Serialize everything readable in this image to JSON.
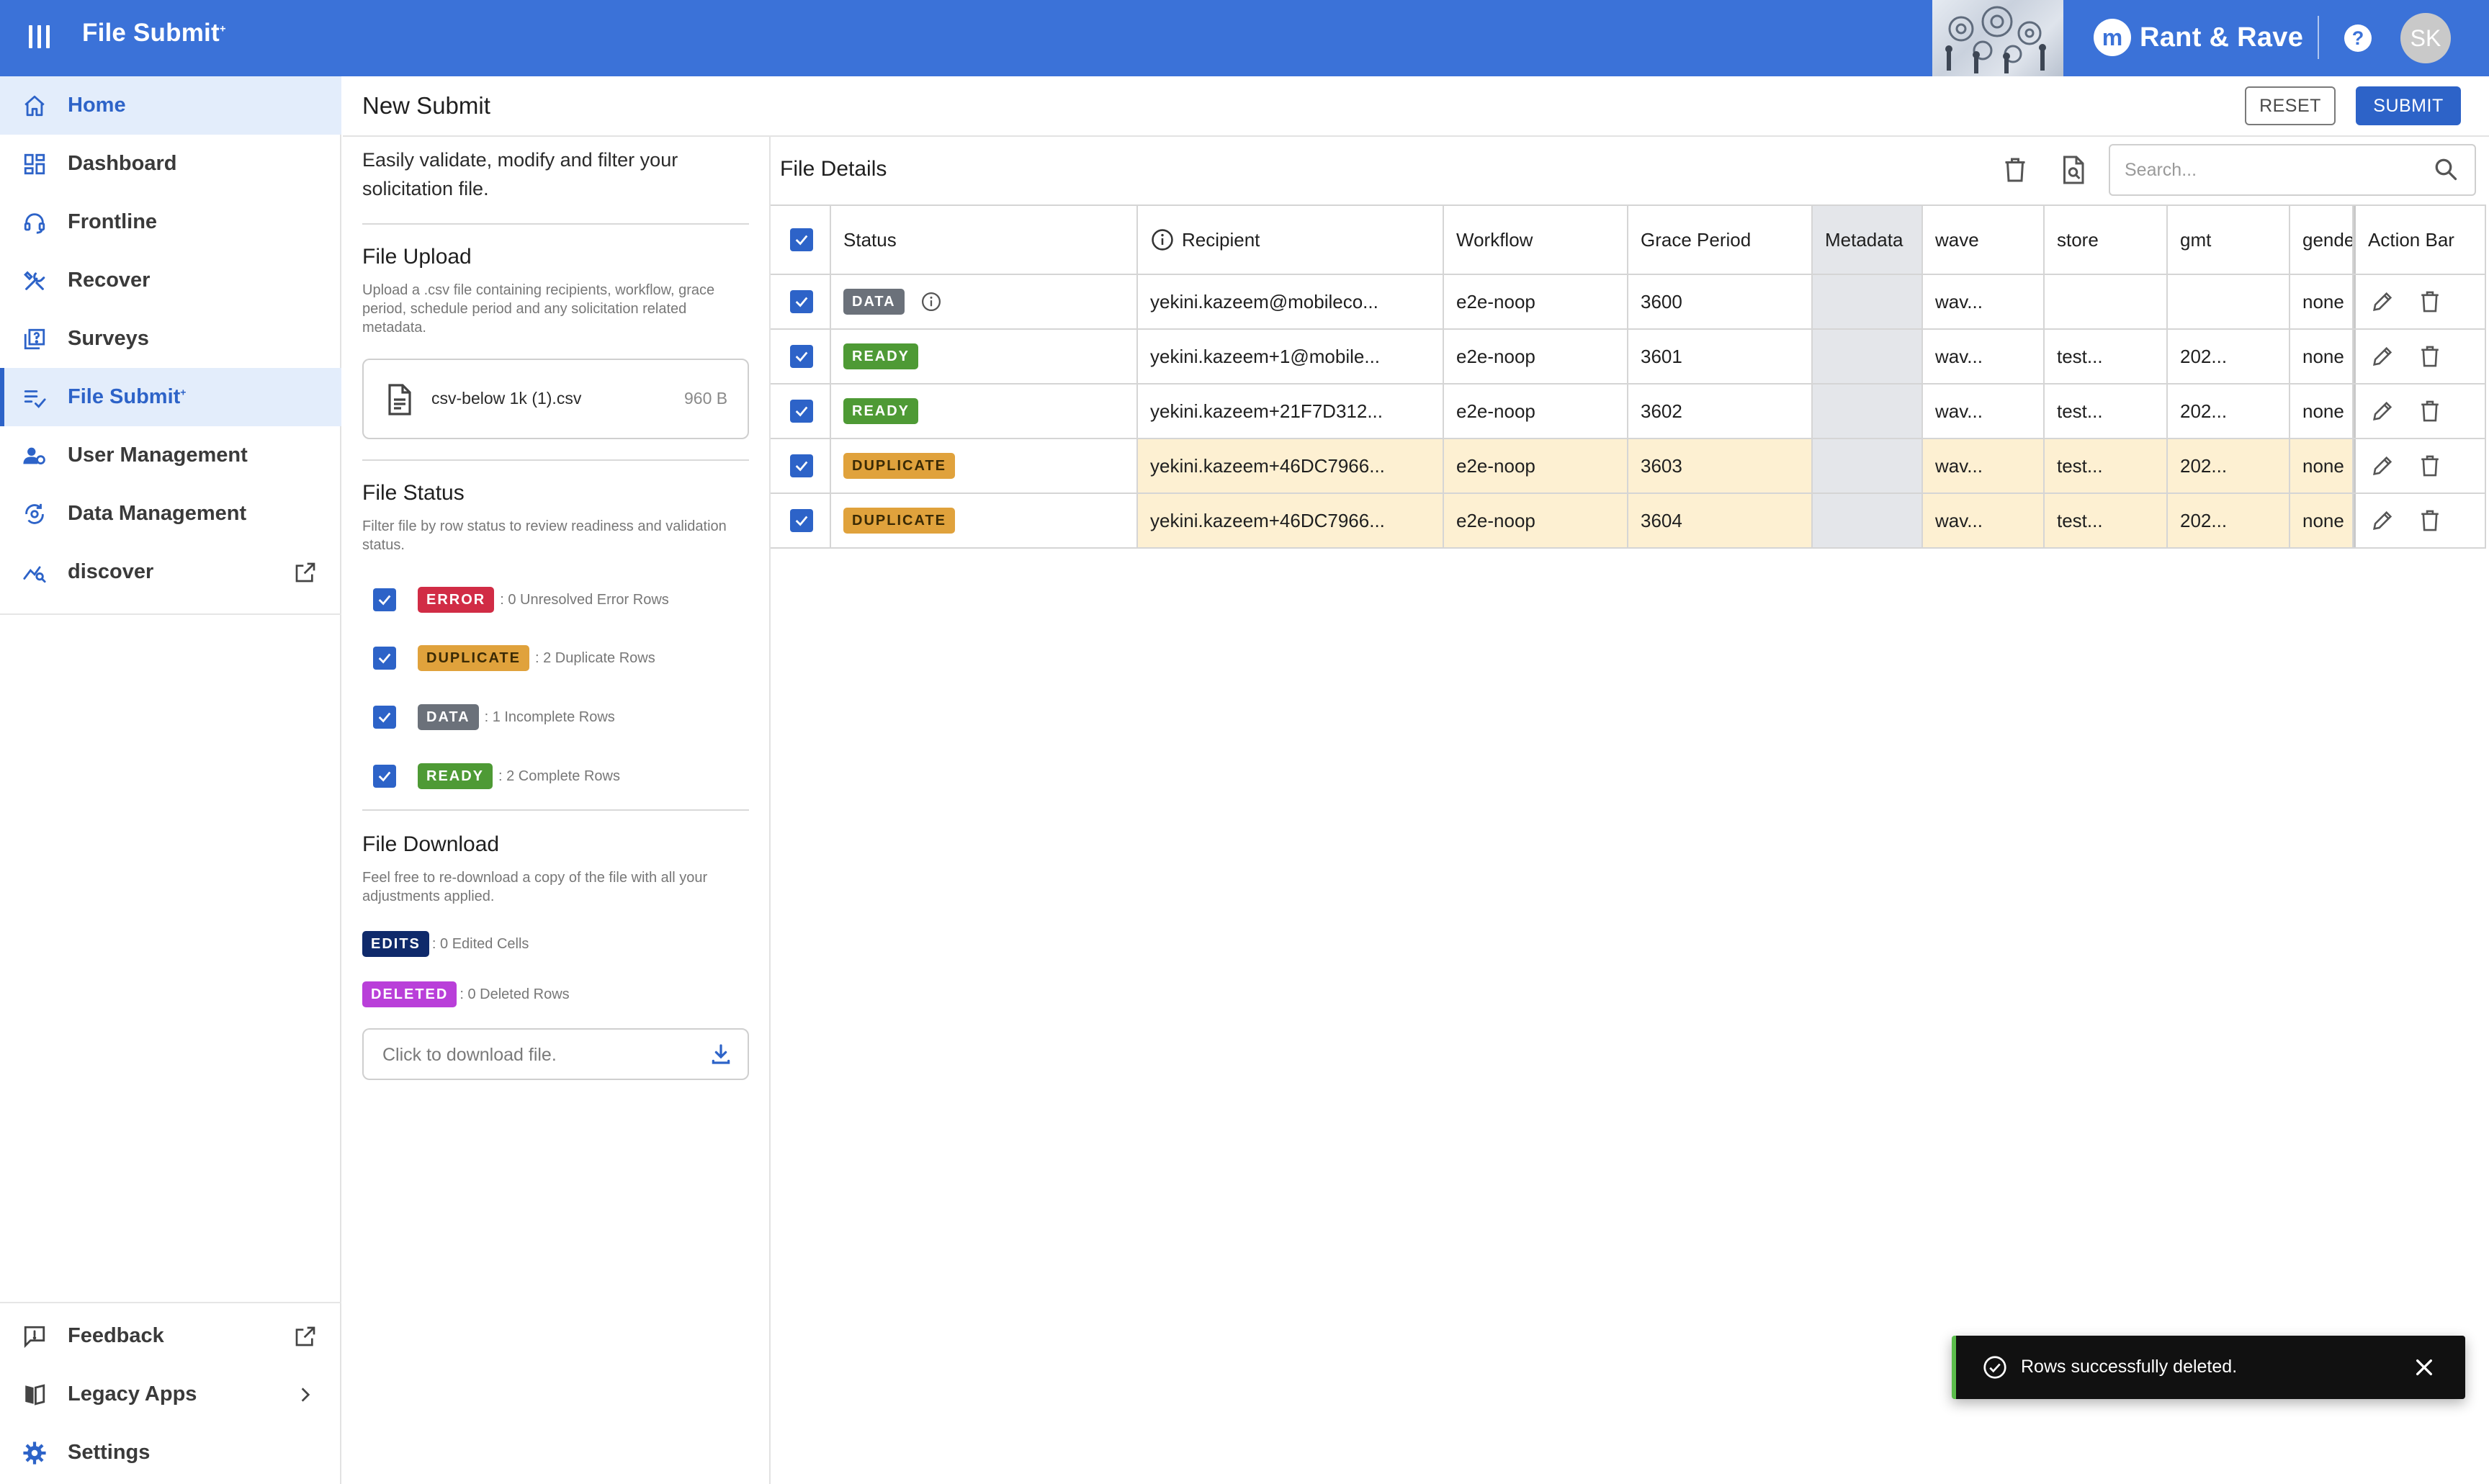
{
  "header": {
    "app_title": "File Submit",
    "app_title_sup": "+",
    "brand_mark": "m",
    "brand_name": "Rant & Rave",
    "help_label": "?",
    "avatar_initials": "SK",
    "header_bg": "#3b72d8"
  },
  "nav": {
    "items": [
      {
        "label": "Home",
        "icon": "home-icon"
      },
      {
        "label": "Dashboard",
        "icon": "dashboard-icon"
      },
      {
        "label": "Frontline",
        "icon": "headset-icon"
      },
      {
        "label": "Recover",
        "icon": "tools-icon"
      },
      {
        "label": "Surveys",
        "icon": "survey-icon"
      },
      {
        "label": "File Submit",
        "label_sup": "+",
        "icon": "file-submit-icon"
      },
      {
        "label": "User Management",
        "icon": "user-management-icon"
      },
      {
        "label": "Data Management",
        "icon": "data-management-icon"
      },
      {
        "label": "discover",
        "icon": "discover-icon",
        "trail_icon": "external-link-icon"
      }
    ],
    "bottom_items": [
      {
        "label": "Feedback",
        "icon": "feedback-icon",
        "trail_icon": "external-link-icon"
      },
      {
        "label": "Legacy Apps",
        "icon": "legacy-apps-icon",
        "trail_icon": "chevron-right-icon"
      },
      {
        "label": "Settings",
        "icon": "gear-icon"
      }
    ]
  },
  "page": {
    "title": "New Submit",
    "reset_label": "RESET",
    "submit_label": "SUBMIT"
  },
  "mid": {
    "intro": "Easily validate, modify and filter your solicitation file.",
    "upload_title": "File Upload",
    "upload_desc": "Upload a .csv file containing recipients, workflow, grace period, schedule period and any solicitation related metadata.",
    "file_name": "csv-below 1k (1).csv",
    "file_size": "960 B",
    "status_title": "File Status",
    "status_desc": "Filter file by row status to review readiness and validation status.",
    "statuses": [
      {
        "badge": "ERROR",
        "desc": ": 0 Unresolved Error Rows",
        "checked": true
      },
      {
        "badge": "DUPLICATE",
        "desc": ": 2 Duplicate Rows",
        "checked": true
      },
      {
        "badge": "DATA",
        "desc": ": 1 Incomplete Rows",
        "checked": true
      },
      {
        "badge": "READY",
        "desc": ": 2 Complete Rows",
        "checked": true
      }
    ],
    "download_title": "File Download",
    "download_desc": "Feel free to re-download a copy of the file with all your adjustments applied.",
    "edits_badge": "EDITS",
    "edits_desc": ": 0 Edited Cells",
    "deleted_badge": "DELETED",
    "deleted_desc": ": 0 Deleted Rows",
    "download_placeholder": "Click to download file."
  },
  "table": {
    "title": "File Details",
    "search_placeholder": "Search...",
    "headers": [
      "Status",
      "Recipient",
      "Workflow",
      "Grace Period",
      "Metadata",
      "wave",
      "store",
      "gmt",
      "gende",
      "Action Bar"
    ],
    "rows": [
      {
        "status": "DATA",
        "recipient": "yekini.kazeem@mobileco...",
        "workflow": "e2e-noop",
        "grace": "3600",
        "metadata": "",
        "wave": "wav...",
        "store": "",
        "gmt": "",
        "gender": "none",
        "checked": true
      },
      {
        "status": "READY",
        "recipient": "yekini.kazeem+1@mobile...",
        "workflow": "e2e-noop",
        "grace": "3601",
        "metadata": "",
        "wave": "wav...",
        "store": "test...",
        "gmt": "202...",
        "gender": "none",
        "checked": true
      },
      {
        "status": "READY",
        "recipient": "yekini.kazeem+21F7D312...",
        "workflow": "e2e-noop",
        "grace": "3602",
        "metadata": "",
        "wave": "wav...",
        "store": "test...",
        "gmt": "202...",
        "gender": "none",
        "checked": true
      },
      {
        "status": "DUPLICATE",
        "recipient": "yekini.kazeem+46DC7966...",
        "workflow": "e2e-noop",
        "grace": "3603",
        "metadata": "",
        "wave": "wav...",
        "store": "test...",
        "gmt": "202...",
        "gender": "none",
        "checked": true
      },
      {
        "status": "DUPLICATE",
        "recipient": "yekini.kazeem+46DC7966...",
        "workflow": "e2e-noop",
        "grace": "3604",
        "metadata": "",
        "wave": "wav...",
        "store": "test...",
        "gmt": "202...",
        "gender": "none",
        "checked": true
      }
    ]
  },
  "toast": {
    "message": "Rows successfully deleted."
  }
}
